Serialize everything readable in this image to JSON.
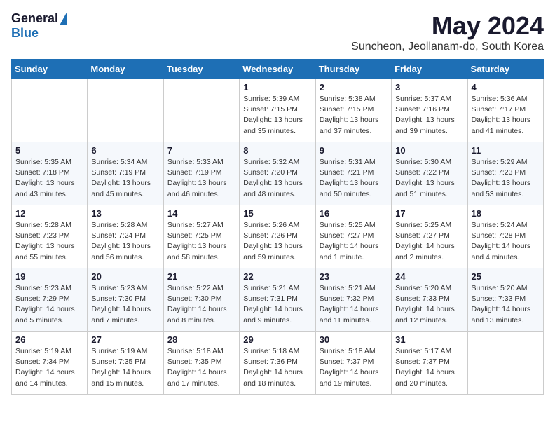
{
  "logo": {
    "general": "General",
    "blue": "Blue"
  },
  "title": {
    "month": "May 2024",
    "location": "Suncheon, Jeollanam-do, South Korea"
  },
  "weekdays": [
    "Sunday",
    "Monday",
    "Tuesday",
    "Wednesday",
    "Thursday",
    "Friday",
    "Saturday"
  ],
  "weeks": [
    [
      {
        "day": "",
        "info": ""
      },
      {
        "day": "",
        "info": ""
      },
      {
        "day": "",
        "info": ""
      },
      {
        "day": "1",
        "info": "Sunrise: 5:39 AM\nSunset: 7:15 PM\nDaylight: 13 hours\nand 35 minutes."
      },
      {
        "day": "2",
        "info": "Sunrise: 5:38 AM\nSunset: 7:15 PM\nDaylight: 13 hours\nand 37 minutes."
      },
      {
        "day": "3",
        "info": "Sunrise: 5:37 AM\nSunset: 7:16 PM\nDaylight: 13 hours\nand 39 minutes."
      },
      {
        "day": "4",
        "info": "Sunrise: 5:36 AM\nSunset: 7:17 PM\nDaylight: 13 hours\nand 41 minutes."
      }
    ],
    [
      {
        "day": "5",
        "info": "Sunrise: 5:35 AM\nSunset: 7:18 PM\nDaylight: 13 hours\nand 43 minutes."
      },
      {
        "day": "6",
        "info": "Sunrise: 5:34 AM\nSunset: 7:19 PM\nDaylight: 13 hours\nand 45 minutes."
      },
      {
        "day": "7",
        "info": "Sunrise: 5:33 AM\nSunset: 7:19 PM\nDaylight: 13 hours\nand 46 minutes."
      },
      {
        "day": "8",
        "info": "Sunrise: 5:32 AM\nSunset: 7:20 PM\nDaylight: 13 hours\nand 48 minutes."
      },
      {
        "day": "9",
        "info": "Sunrise: 5:31 AM\nSunset: 7:21 PM\nDaylight: 13 hours\nand 50 minutes."
      },
      {
        "day": "10",
        "info": "Sunrise: 5:30 AM\nSunset: 7:22 PM\nDaylight: 13 hours\nand 51 minutes."
      },
      {
        "day": "11",
        "info": "Sunrise: 5:29 AM\nSunset: 7:23 PM\nDaylight: 13 hours\nand 53 minutes."
      }
    ],
    [
      {
        "day": "12",
        "info": "Sunrise: 5:28 AM\nSunset: 7:23 PM\nDaylight: 13 hours\nand 55 minutes."
      },
      {
        "day": "13",
        "info": "Sunrise: 5:28 AM\nSunset: 7:24 PM\nDaylight: 13 hours\nand 56 minutes."
      },
      {
        "day": "14",
        "info": "Sunrise: 5:27 AM\nSunset: 7:25 PM\nDaylight: 13 hours\nand 58 minutes."
      },
      {
        "day": "15",
        "info": "Sunrise: 5:26 AM\nSunset: 7:26 PM\nDaylight: 13 hours\nand 59 minutes."
      },
      {
        "day": "16",
        "info": "Sunrise: 5:25 AM\nSunset: 7:27 PM\nDaylight: 14 hours\nand 1 minute."
      },
      {
        "day": "17",
        "info": "Sunrise: 5:25 AM\nSunset: 7:27 PM\nDaylight: 14 hours\nand 2 minutes."
      },
      {
        "day": "18",
        "info": "Sunrise: 5:24 AM\nSunset: 7:28 PM\nDaylight: 14 hours\nand 4 minutes."
      }
    ],
    [
      {
        "day": "19",
        "info": "Sunrise: 5:23 AM\nSunset: 7:29 PM\nDaylight: 14 hours\nand 5 minutes."
      },
      {
        "day": "20",
        "info": "Sunrise: 5:23 AM\nSunset: 7:30 PM\nDaylight: 14 hours\nand 7 minutes."
      },
      {
        "day": "21",
        "info": "Sunrise: 5:22 AM\nSunset: 7:30 PM\nDaylight: 14 hours\nand 8 minutes."
      },
      {
        "day": "22",
        "info": "Sunrise: 5:21 AM\nSunset: 7:31 PM\nDaylight: 14 hours\nand 9 minutes."
      },
      {
        "day": "23",
        "info": "Sunrise: 5:21 AM\nSunset: 7:32 PM\nDaylight: 14 hours\nand 11 minutes."
      },
      {
        "day": "24",
        "info": "Sunrise: 5:20 AM\nSunset: 7:33 PM\nDaylight: 14 hours\nand 12 minutes."
      },
      {
        "day": "25",
        "info": "Sunrise: 5:20 AM\nSunset: 7:33 PM\nDaylight: 14 hours\nand 13 minutes."
      }
    ],
    [
      {
        "day": "26",
        "info": "Sunrise: 5:19 AM\nSunset: 7:34 PM\nDaylight: 14 hours\nand 14 minutes."
      },
      {
        "day": "27",
        "info": "Sunrise: 5:19 AM\nSunset: 7:35 PM\nDaylight: 14 hours\nand 15 minutes."
      },
      {
        "day": "28",
        "info": "Sunrise: 5:18 AM\nSunset: 7:35 PM\nDaylight: 14 hours\nand 17 minutes."
      },
      {
        "day": "29",
        "info": "Sunrise: 5:18 AM\nSunset: 7:36 PM\nDaylight: 14 hours\nand 18 minutes."
      },
      {
        "day": "30",
        "info": "Sunrise: 5:18 AM\nSunset: 7:37 PM\nDaylight: 14 hours\nand 19 minutes."
      },
      {
        "day": "31",
        "info": "Sunrise: 5:17 AM\nSunset: 7:37 PM\nDaylight: 14 hours\nand 20 minutes."
      },
      {
        "day": "",
        "info": ""
      }
    ]
  ]
}
